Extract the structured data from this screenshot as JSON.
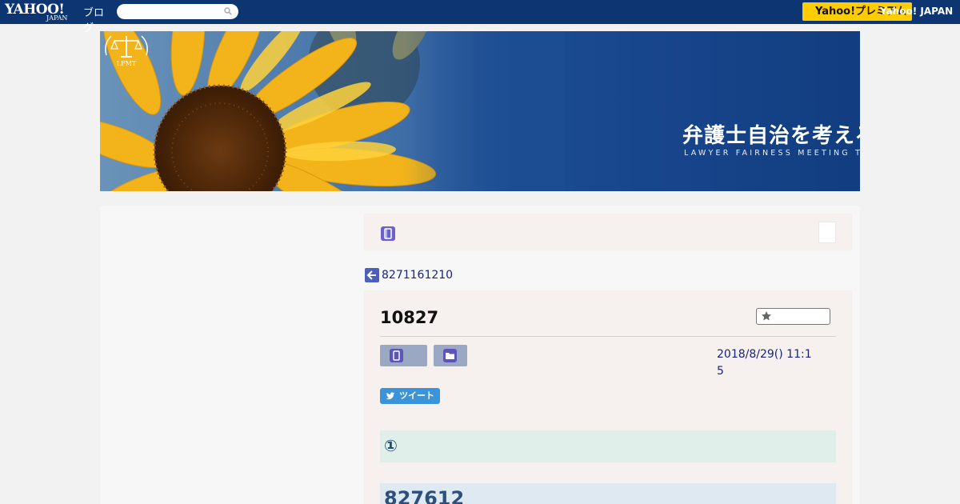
{
  "topbar": {
    "logo_yahoo": "YAHOO!",
    "logo_japan": "JAPAN",
    "logo_blog": "ブログ",
    "search_placeholder": "",
    "promo_button": "Yahoo!プレミアム",
    "yahoo_japan_link": "Yahoo! JAPAN"
  },
  "banner": {
    "title": "弁護士自治を考える会",
    "subtitle": "LAWYER FAIRNESS MEETING THINKS",
    "emblem_text": "LFMT"
  },
  "nav": {
    "back_link": "8271161210"
  },
  "article": {
    "title": "10827",
    "date_line1": "2018/8/29()  11:1",
    "date_line2": "5",
    "tweet_label": "ツイート",
    "heading": "①",
    "number_block": "827612"
  },
  "colors": {
    "topbar_bg": "#0c3572",
    "promo_bg": "#ffcc00",
    "article_bg": "#f6f0ee",
    "tweet_bg": "#3b94d9"
  }
}
